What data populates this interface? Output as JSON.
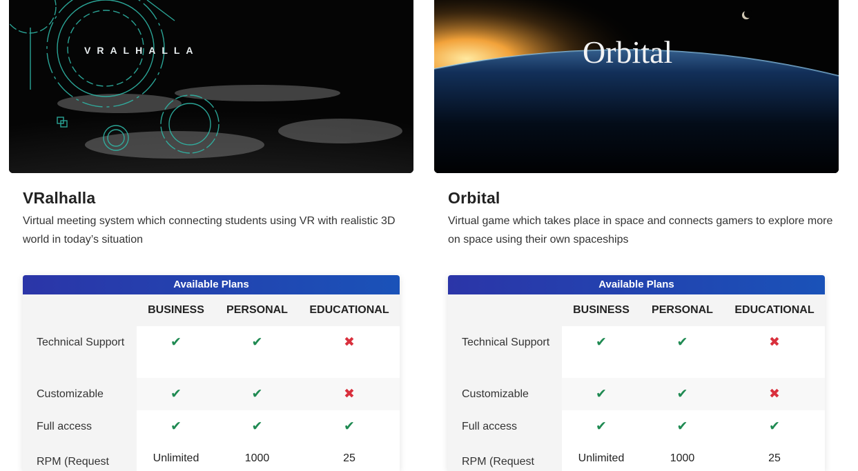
{
  "cards": [
    {
      "hero_text": "VRALHALLA",
      "title": "VRalhalla",
      "description": "Virtual meeting system which connecting students using VR with realistic 3D world in today’s situation",
      "plans": {
        "heading": "Available Plans",
        "columns": [
          "BUSINESS",
          "PERSONAL",
          "EDUCATIONAL"
        ],
        "rows": [
          {
            "feature": "Technical Support",
            "values": [
              "check",
              "check",
              "cross"
            ]
          },
          {
            "feature": "Customizable",
            "values": [
              "check",
              "check",
              "cross"
            ]
          },
          {
            "feature": "Full access",
            "values": [
              "check",
              "check",
              "check"
            ]
          },
          {
            "feature": "RPM (Request",
            "values": [
              "Unlimited",
              "1000",
              "25"
            ]
          }
        ]
      }
    },
    {
      "hero_text": "Orbital",
      "title": "Orbital",
      "description": "Virtual game which takes place in space and connects gamers to explore more on space using their own spaceships",
      "plans": {
        "heading": "Available Plans",
        "columns": [
          "BUSINESS",
          "PERSONAL",
          "EDUCATIONAL"
        ],
        "rows": [
          {
            "feature": "Technical Support",
            "values": [
              "check",
              "check",
              "cross"
            ]
          },
          {
            "feature": "Customizable",
            "values": [
              "check",
              "check",
              "cross"
            ]
          },
          {
            "feature": "Full access",
            "values": [
              "check",
              "check",
              "check"
            ]
          },
          {
            "feature": "RPM (Request",
            "values": [
              "Unlimited",
              "1000",
              "25"
            ]
          }
        ]
      }
    }
  ],
  "icons": {
    "check": "check-icon",
    "cross": "cross-icon"
  },
  "colors": {
    "accent_start": "#2b35a8",
    "accent_end": "#1a52b8",
    "check": "#1f8a52",
    "cross": "#d9303d"
  }
}
